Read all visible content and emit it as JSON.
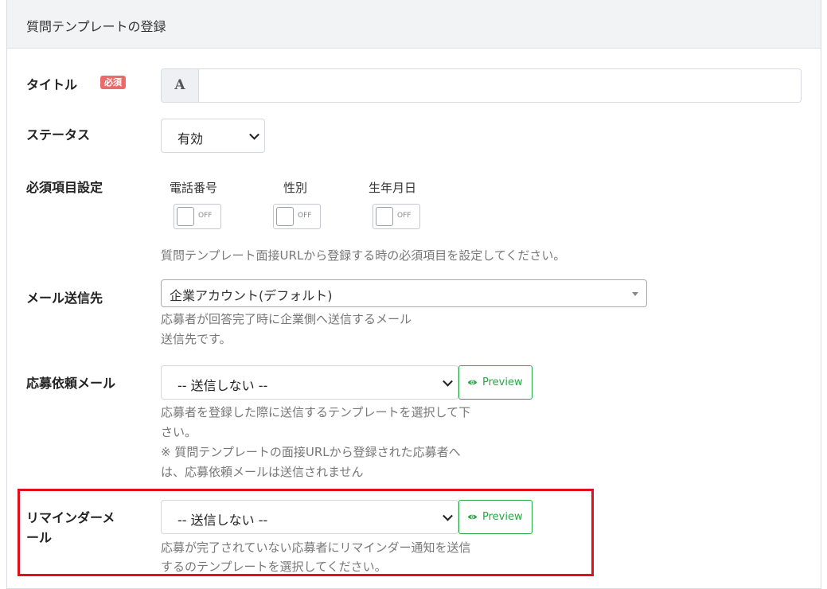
{
  "panel": {
    "title": "質問テンプレートの登録"
  },
  "title_field": {
    "label": "タイトル",
    "required_badge": "必須",
    "addon": "A",
    "value": ""
  },
  "status_field": {
    "label": "ステータス",
    "selected": "有効"
  },
  "required_items": {
    "label": "必須項目設定",
    "toggles": [
      {
        "label": "電話番号",
        "state": "OFF"
      },
      {
        "label": "性別",
        "state": "OFF"
      },
      {
        "label": "生年月日",
        "state": "OFF"
      }
    ],
    "help": "質問テンプレート面接URLから登録する時の必須項目を設定してください。"
  },
  "mail_destination": {
    "label": "メール送信先",
    "selected": "企業アカウント(デフォルト)",
    "help_line1": "応募者が回答完了時に企業側へ送信するメール",
    "help_line2": "送信先です。"
  },
  "application_mail": {
    "label": "応募依頼メール",
    "selected": "-- 送信しない --",
    "preview_label": "Preview",
    "help_line1": "応募者を登録した際に送信するテンプレートを選択して下",
    "help_line2": "さい。",
    "help_line3": "※ 質問テンプレートの面接URLから登録された応募者へ",
    "help_line4": "は、応募依頼メールは送信されません"
  },
  "reminder_mail": {
    "label_line1": "リマインダーメ",
    "label_line2": "ール",
    "selected": "-- 送信しない --",
    "preview_label": "Preview",
    "help_line1": "応募が完了されていない応募者にリマインダー通知を送信",
    "help_line2": "するのテンプレートを選択してください。"
  },
  "colors": {
    "required_badge": "#ec6a6a",
    "preview_green": "#28a745",
    "highlight_red": "#e0101c"
  }
}
